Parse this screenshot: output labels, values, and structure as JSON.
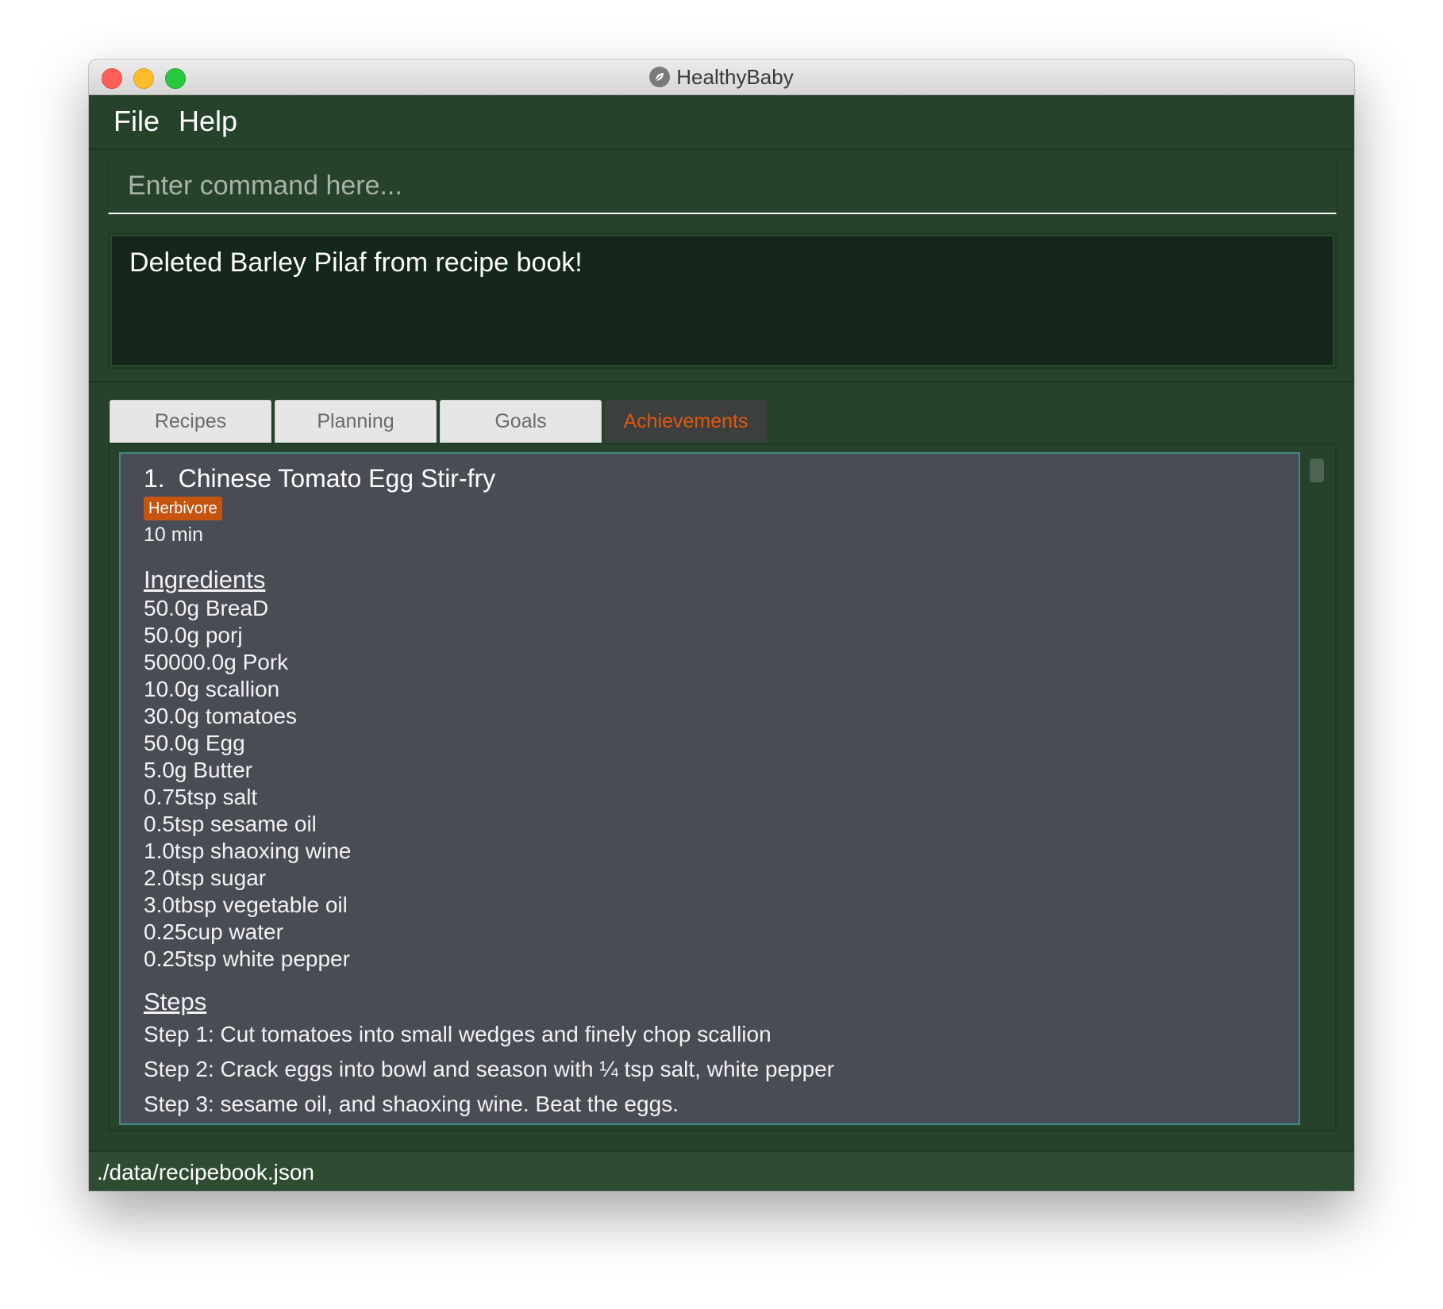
{
  "window": {
    "title": "HealthyBaby"
  },
  "menu": {
    "file": "File",
    "help": "Help"
  },
  "command": {
    "placeholder": "Enter command here..."
  },
  "result": {
    "message": "Deleted Barley Pilaf from recipe book!"
  },
  "tabs": [
    {
      "label": "Recipes"
    },
    {
      "label": "Planning"
    },
    {
      "label": "Goals"
    },
    {
      "label": "Achievements"
    }
  ],
  "recipe": {
    "index": "1.",
    "name": "Chinese Tomato Egg Stir-fry",
    "tag": "Herbivore",
    "time": "10 min",
    "ingredients_heading": "Ingredients",
    "ingredients": [
      "50.0g BreaD",
      "50.0g porj",
      "50000.0g Pork",
      "10.0g scallion",
      "30.0g tomatoes",
      "50.0g Egg",
      "5.0g Butter",
      "0.75tsp salt",
      "0.5tsp sesame oil",
      "1.0tsp shaoxing wine",
      "2.0tsp sugar",
      "3.0tbsp vegetable oil",
      "0.25cup water",
      "0.25tsp white pepper"
    ],
    "steps_heading": "Steps",
    "steps": [
      "Step 1: Cut tomatoes into small wedges and finely chop scallion",
      "Step 2: Crack eggs into bowl and season with ¼ tsp salt, white pepper",
      "Step 3: sesame oil, and shaoxing wine. Beat the eggs."
    ]
  },
  "status": {
    "path": "./data/recipebook.json"
  },
  "colors": {
    "app_background": "#26422a",
    "accent": "#e0570f",
    "tag_background": "#c6540f",
    "card_background": "#494c55"
  }
}
